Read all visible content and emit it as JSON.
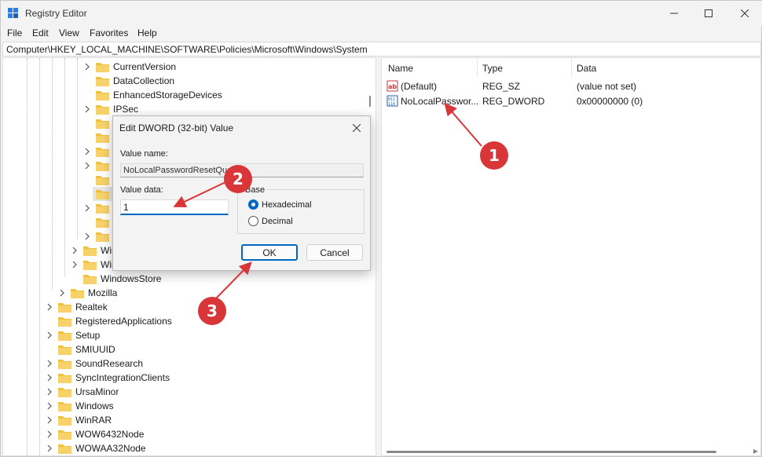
{
  "window": {
    "title": "Registry Editor"
  },
  "menu": [
    "File",
    "Edit",
    "View",
    "Favorites",
    "Help"
  ],
  "address": "Computer\\HKEY_LOCAL_MACHINE\\SOFTWARE\\Policies\\Microsoft\\Windows\\System",
  "tree": {
    "deep": [
      "CurrentVersion",
      "DataCollection",
      "EnhancedStorageDevices",
      "IPSec"
    ],
    "level4": [
      "Win",
      "Win",
      "WindowsStore"
    ],
    "level3": [
      "Mozilla"
    ],
    "level2": [
      "Realtek",
      "RegisteredApplications",
      "Setup",
      "SMIUUID",
      "SoundResearch",
      "SyncIntegrationClients",
      "UrsaMinor",
      "Windows",
      "WinRAR",
      "WOW6432Node",
      "WOWAA32Node"
    ]
  },
  "list": {
    "headers": {
      "name": "Name",
      "type": "Type",
      "data": "Data"
    },
    "rows": [
      {
        "icon": "string-value-icon",
        "name": "(Default)",
        "type": "REG_SZ",
        "data": "(value not set)"
      },
      {
        "icon": "dword-value-icon",
        "name": "NoLocalPasswor...",
        "type": "REG_DWORD",
        "data": "0x00000000 (0)"
      }
    ]
  },
  "dialog": {
    "title": "Edit DWORD (32-bit) Value",
    "value_name_label": "Value name:",
    "value_name": "NoLocalPasswordResetQues",
    "value_data_label": "Value data:",
    "value_data": "1",
    "base_label": "Base",
    "hex_label": "Hexadecimal",
    "dec_label": "Decimal",
    "base_selected": "Hexadecimal",
    "ok_label": "OK",
    "cancel_label": "Cancel"
  },
  "annotations": [
    "1",
    "2",
    "3"
  ],
  "colors": {
    "accent": "#0067c0",
    "badge": "#d9363a",
    "folder": "#f0c040"
  }
}
